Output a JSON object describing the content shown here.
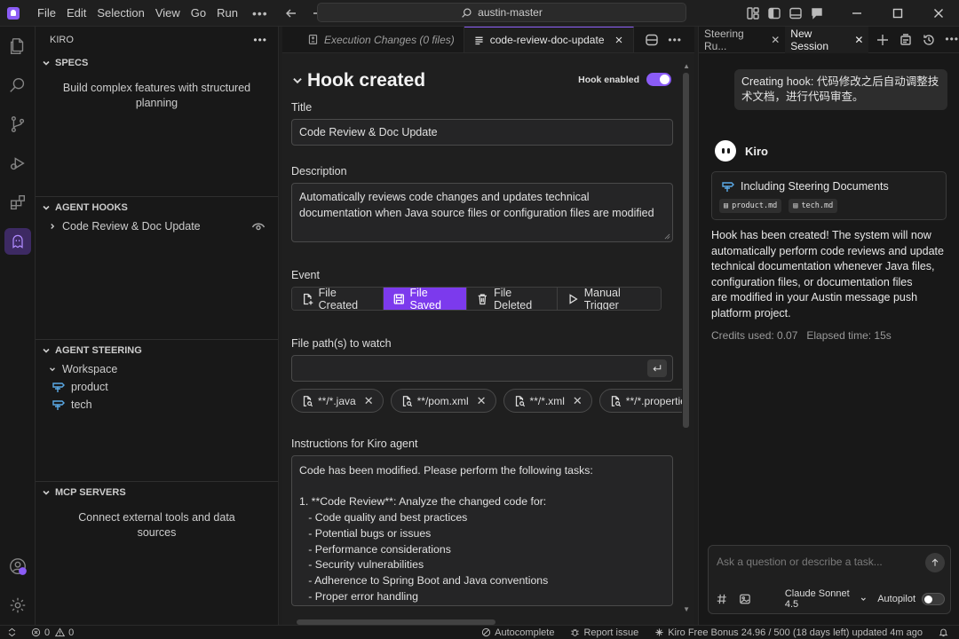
{
  "app": {
    "menu": [
      "File",
      "Edit",
      "Selection",
      "View",
      "Go",
      "Run"
    ],
    "command_center": "austin-master",
    "accent": "#8b5cf6"
  },
  "sidebar": {
    "title": "KIRO",
    "specs": {
      "header": "SPECS",
      "description": "Build complex features with structured planning"
    },
    "agent_hooks": {
      "header": "AGENT HOOKS",
      "items": [
        "Code Review & Doc Update"
      ]
    },
    "agent_steering": {
      "header": "AGENT STEERING",
      "folder": "Workspace",
      "items": [
        "product",
        "tech"
      ]
    },
    "mcp_servers": {
      "header": "MCP SERVERS",
      "description": "Connect external tools and data sources"
    }
  },
  "editor": {
    "tabs": [
      {
        "label": "Execution Changes (0 files)",
        "active": false
      },
      {
        "label": "code-review-doc-update",
        "active": true
      }
    ],
    "heading": "Hook created",
    "hook_enabled_label": "Hook enabled",
    "title_label": "Title",
    "title_value": "Code Review & Doc Update",
    "description_label": "Description",
    "description_value": "Automatically reviews code changes and updates technical documentation when Java source files or configuration files are modified",
    "event_label": "Event",
    "events": [
      {
        "label": "File Created",
        "icon": "file-plus-icon",
        "selected": false
      },
      {
        "label": "File Saved",
        "icon": "save-icon",
        "selected": true
      },
      {
        "label": "File Deleted",
        "icon": "trash-icon",
        "selected": false
      },
      {
        "label": "Manual Trigger",
        "icon": "play-icon",
        "selected": false
      }
    ],
    "paths_label": "File path(s) to watch",
    "paths_input_value": "",
    "paths": [
      "**/*.java",
      "**/pom.xml",
      "**/*.xml",
      "**/*.properties"
    ],
    "instructions_label": "Instructions for Kiro agent",
    "instructions_value": "Code has been modified. Please perform the following tasks:\n\n1. **Code Review**: Analyze the changed code for:\n   - Code quality and best practices\n   - Potential bugs or issues\n   - Performance considerations\n   - Security vulnerabilities\n   - Adherence to Spring Boot and Java conventions\n   - Proper error handling"
  },
  "chat": {
    "tabs": [
      {
        "label": "Steering Ru...",
        "active": false
      },
      {
        "label": "New Session",
        "active": true
      }
    ],
    "user_message": "Creating hook: 代码修改之后自动调整技术文档，进行代码审查。",
    "assistant_name": "Kiro",
    "steering_card_title": "Including Steering Documents",
    "steering_docs": [
      "product.md",
      "tech.md"
    ],
    "reply": "Hook has been created! The system will now\nautomatically perform code reviews and update\ntechnical documentation whenever Java files,\nconfiguration files, or documentation files\nare modified in your Austin message push\nplatform project.",
    "credits": "Credits used: 0.07",
    "elapsed": "Elapsed time: 15s",
    "input_placeholder": "Ask a question or describe a task...",
    "model": "Claude Sonnet 4.5",
    "autopilot_label": "Autopilot"
  },
  "statusbar": {
    "errors": "0",
    "warnings": "0",
    "autocomplete": "Autocomplete",
    "report_issue": "Report issue",
    "bonus": "Kiro Free Bonus 24.96 / 500 (18 days left) updated 4m ago"
  }
}
